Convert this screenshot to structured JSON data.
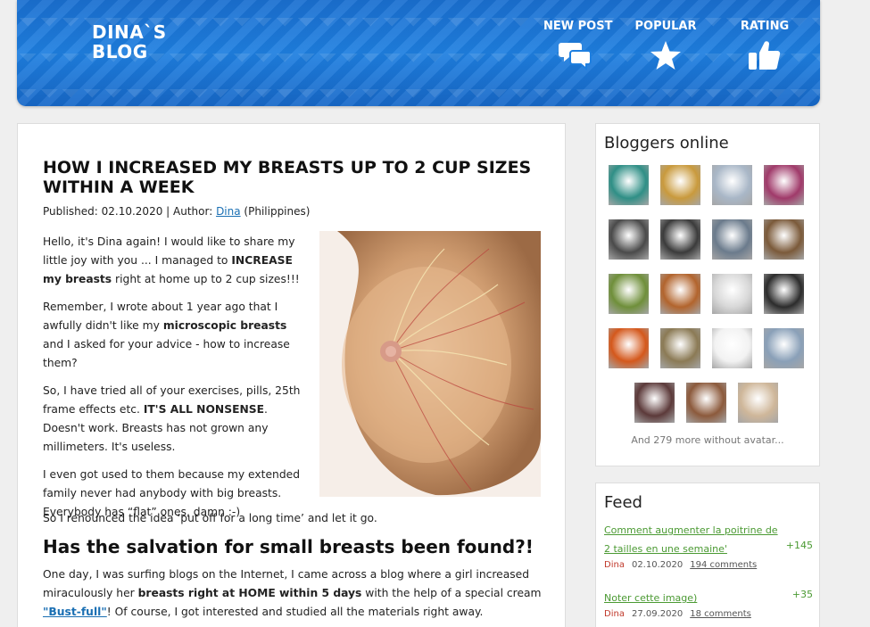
{
  "header": {
    "logo_line1": "DINA`S",
    "logo_line2": "BLOG",
    "nav": {
      "new_post": "NEW POST",
      "popular": "POPULAR",
      "rating": "RATING"
    }
  },
  "article": {
    "title": "HOW I INCREASED MY BREASTS UP TO 2 CUP SIZES WITHIN A WEEK",
    "meta_prefix": "Published: 02.10.2020 | Author: ",
    "author": "Dina",
    "meta_suffix": " (Philippines)",
    "p1_a": "Hello, it's Dina again! I would like to share my little joy with you ... I managed to ",
    "p1_b": "INCREASE my breasts",
    "p1_c": " right at home up to 2 cup sizes!!!",
    "p2_a": "Remember, I wrote about 1 year ago that I awfully didn't like my ",
    "p2_b": "microscopic breasts",
    "p2_c": " and I asked for your advice - how to increase them?",
    "p3_a": "So, I have tried all of your exercises, pills, 25th frame effects etc. ",
    "p3_b": "IT'S ALL NONSENSE",
    "p3_c": ". Doesn't work. Breasts has not grown any millimeters. It's useless.",
    "p4": "I even got used to them because my extended family never had anybody with big breasts. Everybody has “flat” ones, damn :-)",
    "p5": "So I renounced the idea ‘put off for a long time’ and let it go.",
    "h2": "Has the salvation for small breasts been found?!",
    "p6_a": "One day, I was surfing blogs on the Internet, I came across a blog where a girl increased miraculously her ",
    "p6_b": "breasts right at HOME within 5 days",
    "p6_c": " with the help of a special cream ",
    "p6_link": "\"Bust-full\"",
    "p6_d": "! Of course, I got interested and studied all the materials right away."
  },
  "bloggers": {
    "title": "Bloggers online",
    "more": "And 279 more without avatar...",
    "avatar_colors": [
      "#2f8f86",
      "#c99a3d",
      "#a9b7c7",
      "#a03a6a",
      "#4a4a4a",
      "#3b3b3b",
      "#6b7b8c",
      "#7b5a3a",
      "#6f8f3a",
      "#b2642d",
      "#d8d8d8",
      "#2c2c2c",
      "#d4581c",
      "#8b7a55",
      "#f2f2f2",
      "#8aa0b8",
      "#5c3a3a",
      "#8c5a3c",
      "#cfb79a"
    ]
  },
  "feed": {
    "title": "Feed",
    "items": [
      {
        "link": "Comment augmenter la poitrine de 2 tailles en une semaine'",
        "score": "+145",
        "author": "Dina",
        "date": "02.10.2020",
        "comments": "194 comments"
      },
      {
        "link": "Noter cette image)",
        "score": "+35",
        "author": "Dina",
        "date": "27.09.2020",
        "comments": "18 comments"
      }
    ]
  }
}
